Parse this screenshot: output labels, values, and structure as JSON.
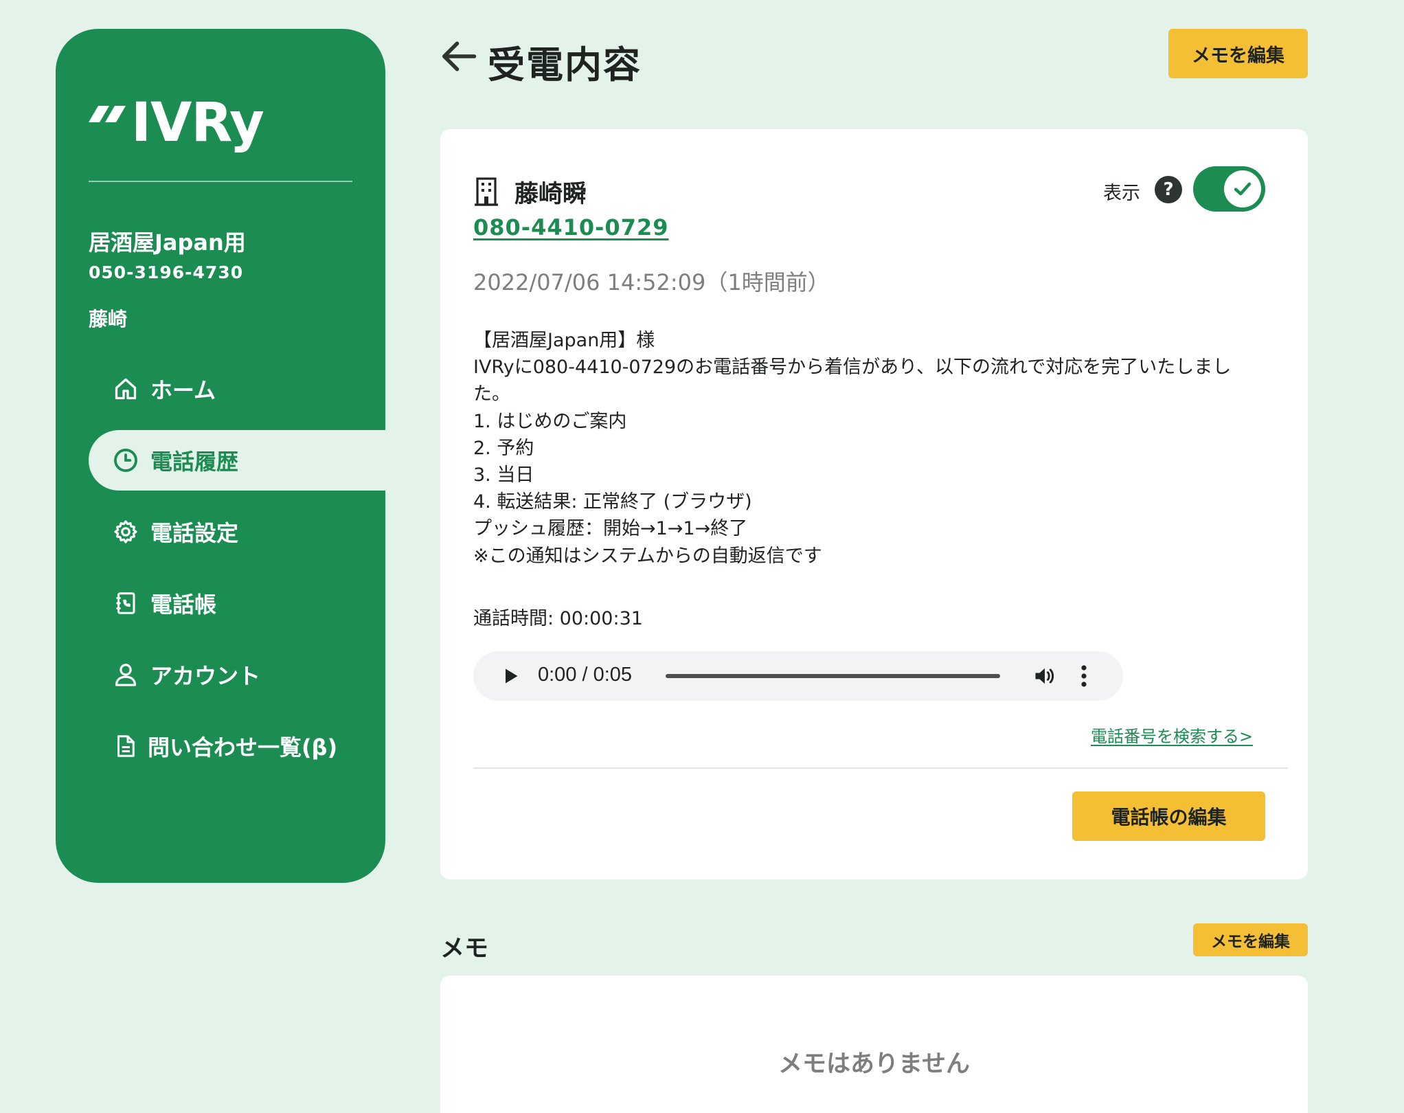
{
  "sidebar": {
    "logo_text": "IVRy",
    "account_name": "居酒屋Japan用",
    "account_phone": "050-3196-4730",
    "user_name": "藤崎",
    "nav": [
      {
        "label": "ホーム",
        "icon": "home-icon"
      },
      {
        "label": "電話履歴",
        "icon": "clock-icon",
        "active": true
      },
      {
        "label": "電話設定",
        "icon": "gear-icon"
      },
      {
        "label": "電話帳",
        "icon": "phonebook-icon"
      },
      {
        "label": "アカウント",
        "icon": "user-icon"
      },
      {
        "label": "問い合わせ一覧(β)",
        "icon": "document-icon"
      }
    ]
  },
  "header": {
    "title": "受電内容",
    "edit_memo_label": "メモを編集"
  },
  "call": {
    "caller_name": "藤崎瞬",
    "caller_phone": "080-4410-0729",
    "display_label": "表示",
    "help_label": "?",
    "display_toggle_on": true,
    "datetime": "2022/07/06 14:52:09（1時間前）",
    "message_lines": [
      "【居酒屋Japan用】様",
      "IVRyに080-4410-0729のお電話番号から着信があり、以下の流れで対応を完了いたしまし",
      "た。",
      "1. はじめのご案内",
      "2. 予約",
      "3. 当日",
      "4. 転送結果: 正常終了 (ブラウザ)",
      "プッシュ履歴：開始→1→1→終了",
      "※この通知はシステムからの自動返信です"
    ],
    "duration": "通話時間: 00:00:31",
    "audio": {
      "time": "0:00 / 0:05",
      "progress": 0
    },
    "search_link": "電話番号を検索する>",
    "edit_phonebook_label": "電話帳の編集"
  },
  "memo": {
    "title": "メモ",
    "edit_label": "メモを編集",
    "empty_text": "メモはありません"
  },
  "colors": {
    "brand_green": "#1b8c52",
    "background": "#e4f3ea",
    "button_yellow": "#f5bf35"
  }
}
